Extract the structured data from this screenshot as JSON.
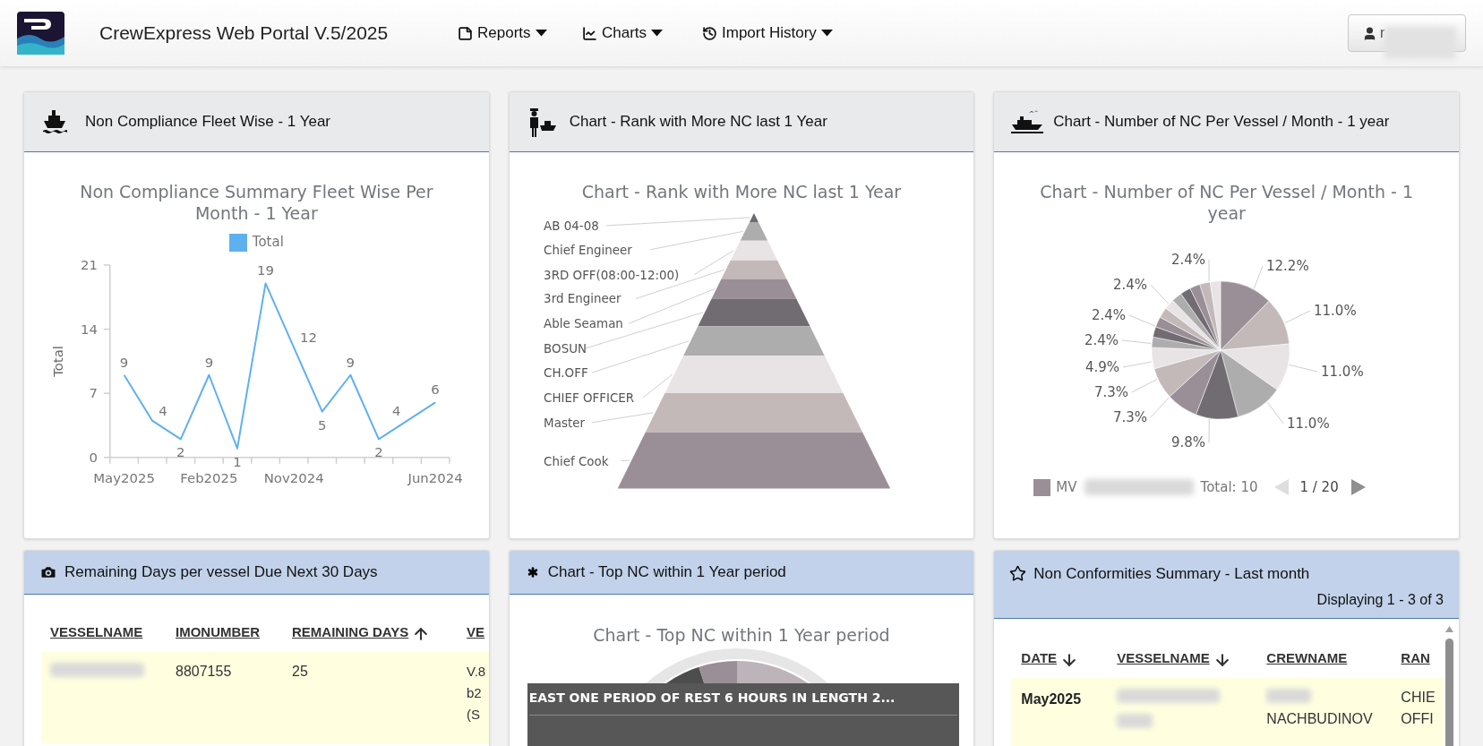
{
  "navbar": {
    "title": "CrewExpress Web Portal V.5/2025",
    "menus": [
      {
        "label": "Reports"
      },
      {
        "label": "Charts"
      },
      {
        "label": "Import History"
      }
    ],
    "user_name": "r"
  },
  "fleet_chart": {
    "header": "Non Compliance Fleet Wise - 1 Year",
    "chart_data": {
      "type": "line",
      "title": "Non Compliance Summary Fleet Wise Per Month - 1 Year",
      "ylabel": "Total",
      "categories": [
        "May2025",
        null,
        null,
        "Feb2025",
        null,
        null,
        "Nov2024",
        null,
        null,
        null,
        null,
        "Jun2024"
      ],
      "series": [
        {
          "name": "Total",
          "color": "#5fb0ef",
          "values": [
            9,
            4,
            2,
            9,
            1,
            19,
            12,
            5,
            9,
            2,
            4,
            6
          ]
        }
      ],
      "ylim": [
        0,
        21
      ],
      "yticks": [
        0,
        7,
        14,
        21
      ],
      "data_labels": true
    }
  },
  "rank_chart": {
    "header": "Chart - Rank with More NC last 1 Year",
    "title": "Chart - Rank with More NC last 1 Year",
    "ranks": [
      "AB 04-08",
      "Chief Engineer",
      "3RD OFF(08:00-12:00)",
      "3rd Engineer",
      "Able Seaman",
      "BOSUN",
      "CH.OFF",
      "CHIEF OFFICER",
      "Master",
      "Chief Cook"
    ]
  },
  "vessel_chart": {
    "header": "Chart - Number of NC Per Vessel / Month - 1 year",
    "title": "Chart - Number of NC Per Vessel / Month - 1 year",
    "slice_labels": [
      "2.4%",
      "12.2%",
      "2.4%",
      "11.0%",
      "2.4%",
      "2.4%",
      "4.9%",
      "11.0%",
      "7.3%",
      "7.3%",
      "11.0%",
      "9.8%"
    ],
    "legend": {
      "color": "#9a8f97",
      "prefix": "MV",
      "total": "Total: 10"
    },
    "pager": {
      "text": "1 / 20",
      "prev_enabled": false,
      "next_enabled": true
    }
  },
  "remaining_days": {
    "header": "Remaining Days per vessel Due Next 30 Days",
    "columns": [
      {
        "label": "VESSELNAME",
        "sort_up": false,
        "sort_down": false
      },
      {
        "label": "IMONUMBER",
        "sort_up": false,
        "sort_down": false
      },
      {
        "label": "REMAINING DAYS",
        "sort_up": true,
        "sort_down": false
      },
      {
        "label": "VE",
        "sort_up": false,
        "sort_down": false
      }
    ],
    "rows": [
      {
        "selected": true,
        "imonumber": "8807155",
        "remaining_days": "25",
        "column_4": [
          "V.8",
          "b2",
          "(S"
        ]
      }
    ]
  },
  "top_nc": {
    "header": "Chart - Top NC within 1 Year period",
    "title": "Chart - Top NC within 1 Year period",
    "tooltip": "EAST ONE PERIOD OF REST 6 HOURS IN LENGTH 2..."
  },
  "nc_summary": {
    "header": "Non Conformities Summary - Last month",
    "displaying": "Displaying 1 - 3 of 3",
    "columns": [
      {
        "label": "DATE",
        "sort_up": false,
        "sort_down": true
      },
      {
        "label": "VESSELNAME",
        "sort_up": false,
        "sort_down": true
      },
      {
        "label": "CREWNAME",
        "sort_up": false,
        "sort_down": false
      },
      {
        "label": "RAN",
        "sort_up": false,
        "sort_down": false
      }
    ],
    "rows": [
      {
        "selected": true,
        "date": "May2025",
        "crewname": "NACHBUDINOV",
        "rank": [
          "CHIE",
          "OFFI"
        ]
      }
    ]
  }
}
